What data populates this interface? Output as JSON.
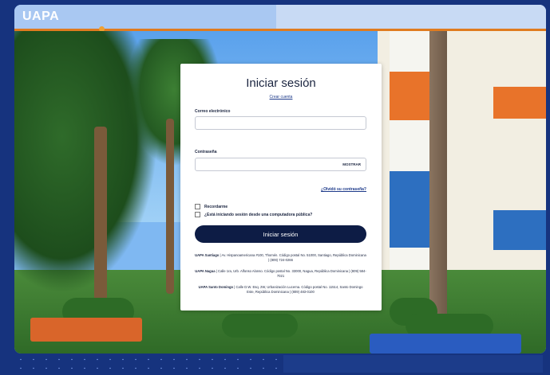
{
  "header": {
    "logo_text": "UAPA"
  },
  "login": {
    "title": "Iniciar sesión",
    "create_account": "Crear cuenta",
    "email_label": "Correo electrónico",
    "email_value": "",
    "password_label": "Contraseña",
    "password_value": "",
    "show_label": "MOSTRAR",
    "forgot_label": "¿Olvidó su contraseña?",
    "remember_label": "Recordarme",
    "public_pc_label": "¿Está iniciando sesión desde una computadora pública?",
    "submit_label": "Iniciar sesión"
  },
  "campuses": [
    {
      "name": "UAPA Santiago",
      "text": " | Av. Hispanoamericana #100, Thomén. Código postal No. 51000, Santiago, República Dominicana | (809) 724-0266"
    },
    {
      "name": "UAPA Nagua",
      "text": " | Calle 1ra, Urb. Alfonso Alonso. Código postal No. 33000, Nagua, República Dominicana | (809) 584-7021"
    },
    {
      "name": "UAPA Santo Domingo",
      "text": " | Calle D.W. Esq. 2W, Urbanización Lucerna. Código postal No. 11514, Santo Domingo Este, República Dominicana | (809) 483-0100"
    }
  ],
  "colors": {
    "accent_orange": "#e07b1f",
    "button_navy": "#0d1c45",
    "frame_blue": "#16337e"
  }
}
